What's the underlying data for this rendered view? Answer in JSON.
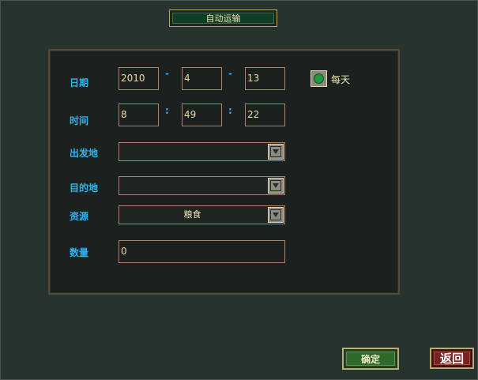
{
  "title": "自动运输",
  "labels": {
    "date": "日期",
    "time": "时间",
    "departure": "出发地",
    "destination": "目的地",
    "resource": "资源",
    "quantity": "数量"
  },
  "date": {
    "year": "2010",
    "month": "4",
    "day": "13",
    "separator": "-"
  },
  "time": {
    "hour": "8",
    "minute": "49",
    "second": "22",
    "separator": ":"
  },
  "daily": {
    "label": "每天",
    "checked": true
  },
  "departure_value": "",
  "destination_value": "",
  "resource_value": "粮食",
  "quantity_value": "0",
  "buttons": {
    "confirm": "确定",
    "back": "返回"
  },
  "colors": {
    "label": "#2fb3ea",
    "value": "#f0dca0",
    "confirm": "#2f6a2b",
    "back": "#7a231e"
  },
  "icons": {
    "dropdown": "chevron-down-icon",
    "radio": "radio-dot-icon"
  }
}
